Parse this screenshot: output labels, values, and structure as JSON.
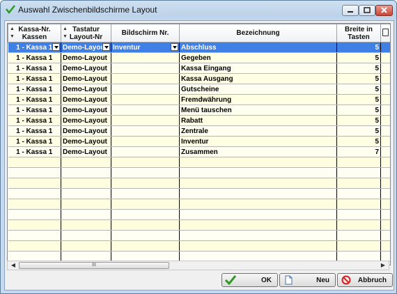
{
  "window": {
    "title": "Auswahl Zwischenbildschirme Layout"
  },
  "columns": [
    {
      "label": "Kassa-Nr.\nKassen",
      "sortable": true
    },
    {
      "label": "Tastatur\nLayout-Nr",
      "sortable": true
    },
    {
      "label": "Bildschirm Nr.",
      "sortable": false
    },
    {
      "label": "Bezeichnung",
      "sortable": false
    },
    {
      "label": "Breite in\nTasten",
      "sortable": false
    }
  ],
  "rows": [
    {
      "kassa": "1 - Kassa 1",
      "layout": "Demo-Layout",
      "bildschirm": "Inventur",
      "bezeichnung": "Abschluss",
      "breite": "5"
    },
    {
      "kassa": "1 - Kassa 1",
      "layout": "Demo-Layout",
      "bildschirm": "",
      "bezeichnung": "Gegeben",
      "breite": "5"
    },
    {
      "kassa": "1 - Kassa 1",
      "layout": "Demo-Layout",
      "bildschirm": "",
      "bezeichnung": "Kassa Eingang",
      "breite": "5"
    },
    {
      "kassa": "1 - Kassa 1",
      "layout": "Demo-Layout",
      "bildschirm": "",
      "bezeichnung": "Kassa Ausgang",
      "breite": "5"
    },
    {
      "kassa": "1 - Kassa 1",
      "layout": "Demo-Layout",
      "bildschirm": "",
      "bezeichnung": "Gutscheine",
      "breite": "5"
    },
    {
      "kassa": "1 - Kassa 1",
      "layout": "Demo-Layout",
      "bildschirm": "",
      "bezeichnung": "Fremdwährung",
      "breite": "5"
    },
    {
      "kassa": "1 - Kassa 1",
      "layout": "Demo-Layout",
      "bildschirm": "",
      "bezeichnung": "Menü tauschen",
      "breite": "5"
    },
    {
      "kassa": "1 - Kassa 1",
      "layout": "Demo-Layout",
      "bildschirm": "",
      "bezeichnung": "Rabatt",
      "breite": "5"
    },
    {
      "kassa": "1 - Kassa 1",
      "layout": "Demo-Layout",
      "bildschirm": "",
      "bezeichnung": "Zentrale",
      "breite": "5"
    },
    {
      "kassa": "1 - Kassa 1",
      "layout": "Demo-Layout",
      "bildschirm": "",
      "bezeichnung": "Inventur",
      "breite": "5"
    },
    {
      "kassa": "1 - Kassa 1",
      "layout": "Demo-Layout",
      "bildschirm": "",
      "bezeichnung": "Zusammen",
      "breite": "7"
    }
  ],
  "selected_row": 0,
  "scrollbar": {
    "thumb_label": "III"
  },
  "buttons": {
    "ok": "OK",
    "neu": "Neu",
    "abbruch": "Abbruch"
  },
  "colors": {
    "selection": "#3f80e6",
    "row_bg": "#fffff0",
    "title_bg": "#bcd3ea"
  },
  "icons": [
    "checkmark-icon",
    "minimize-icon",
    "maximize-icon",
    "close-icon",
    "column-chooser-icon",
    "dropdown-arrow-icon",
    "new-document-icon",
    "cancel-icon"
  ]
}
